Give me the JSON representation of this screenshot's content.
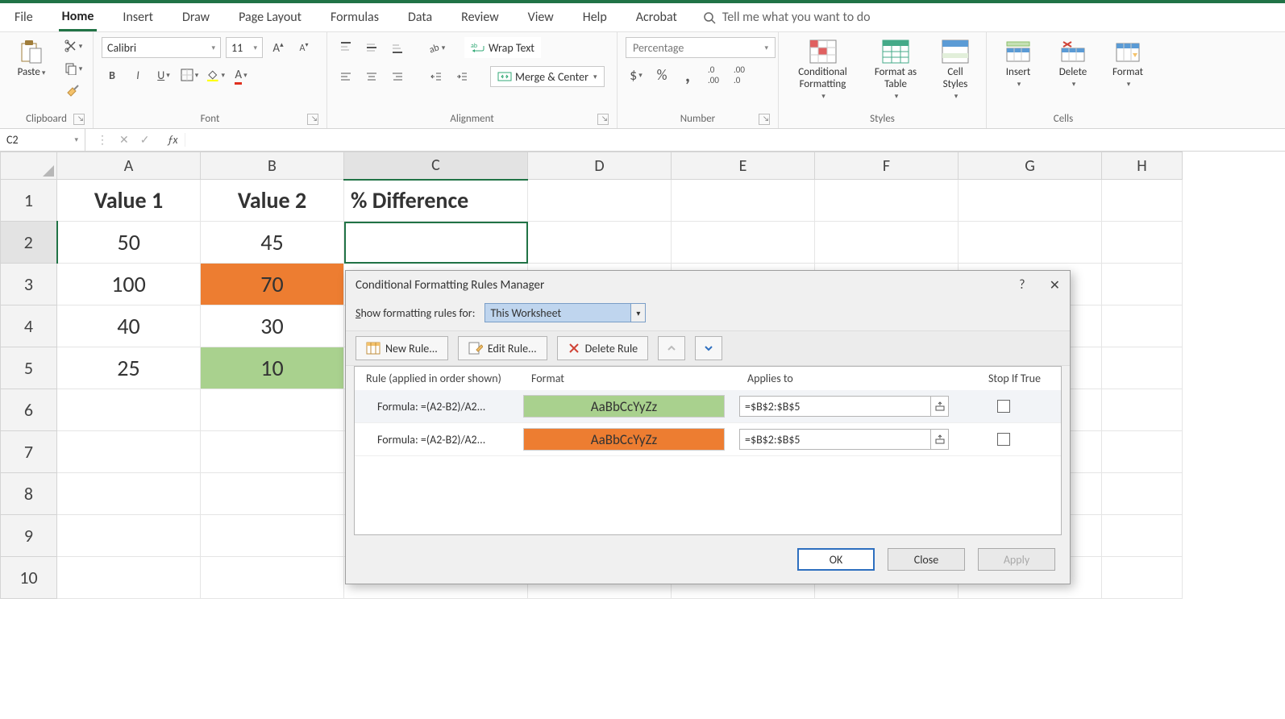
{
  "tabs": {
    "file": "File",
    "home": "Home",
    "insert": "Insert",
    "draw": "Draw",
    "page_layout": "Page Layout",
    "formulas": "Formulas",
    "data": "Data",
    "review": "Review",
    "view": "View",
    "help": "Help",
    "acrobat": "Acrobat",
    "search_placeholder": "Tell me what you want to do"
  },
  "ribbon": {
    "clipboard": {
      "paste": "Paste",
      "label": "Clipboard"
    },
    "font": {
      "family": "Calibri",
      "size": "11",
      "label": "Font",
      "bold": "B",
      "italic": "I",
      "underline": "U"
    },
    "alignment": {
      "wrap": "Wrap Text",
      "merge": "Merge & Center",
      "label": "Alignment"
    },
    "number": {
      "format": "Percentage",
      "label": "Number",
      "currency": "$",
      "percent": "%",
      "comma": ",",
      "inc": ".00",
      "dec": ".0"
    },
    "styles": {
      "cf": "Conditional Formatting",
      "fat": "Format as Table",
      "cs": "Cell Styles",
      "label": "Styles"
    },
    "cells": {
      "insert": "Insert",
      "delete": "Delete",
      "format": "Format",
      "label": "Cells"
    }
  },
  "nameBox": "C2",
  "formulaBar": "",
  "columns": [
    "A",
    "B",
    "C",
    "D",
    "E",
    "F",
    "G",
    "H"
  ],
  "rows": [
    "1",
    "2",
    "3",
    "4",
    "5",
    "6",
    "7",
    "8",
    "9",
    "10"
  ],
  "cells": {
    "A1": "Value 1",
    "B1": "Value 2",
    "C1": "% Difference",
    "A2": "50",
    "B2": "45",
    "A3": "100",
    "B3": "70",
    "A4": "40",
    "B4": "30",
    "A5": "25",
    "B5": "10"
  },
  "dialog": {
    "title": "Conditional Formatting Rules Manager",
    "help": "?",
    "close": "✕",
    "show_for_label": "Show formatting rules for:",
    "show_for_value": "This Worksheet",
    "new_rule": "New Rule...",
    "edit_rule": "Edit Rule...",
    "delete_rule": "Delete Rule",
    "col_rule": "Rule (applied in order shown)",
    "col_format": "Format",
    "col_applies": "Applies to",
    "col_stop": "Stop If True",
    "rules": [
      {
        "formula": "Formula: =(A2-B2)/A2...",
        "format_sample": "AaBbCcYyZz",
        "format_fill": "#a9d18e",
        "applies": "=$B$2:$B$5"
      },
      {
        "formula": "Formula: =(A2-B2)/A2...",
        "format_sample": "AaBbCcYyZz",
        "format_fill": "#ed7d31",
        "applies": "=$B$2:$B$5"
      }
    ],
    "ok": "OK",
    "close_btn": "Close",
    "apply": "Apply"
  }
}
